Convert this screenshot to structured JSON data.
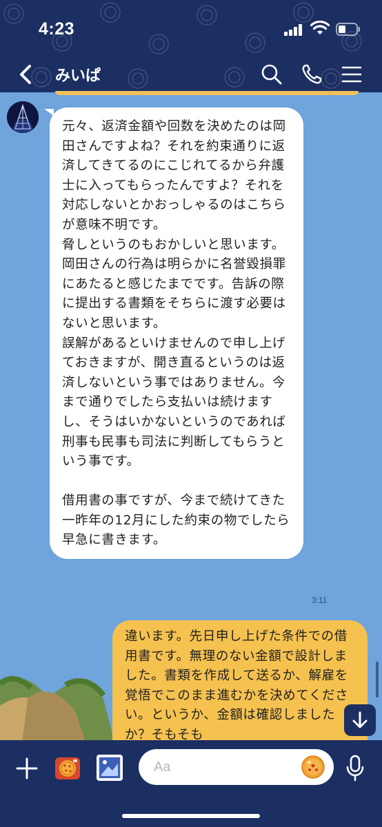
{
  "status_bar": {
    "time": "4:23"
  },
  "header": {
    "title": "みいぱ"
  },
  "messages": {
    "incoming_text": "元々、返済金額や回数を決めたのは岡田さんですよね？それを約束通りに返済してきてるのにこじれてるから弁護士に入ってもらったんですよ？それを対応しないとかおっしゃるのはこちらが意味不明です。\n脅しというのもおかしいと思います。岡田さんの行為は明らかに名誉毀損罪にあたると感じたまでです。告訴の際に提出する書類をそちらに渡す必要はないと思います。\n誤解があるといけませんので申し上げておきますが、開き直るというのは返済しないという事ではありません。今まで通りでしたら支払いは続けますし、そうはいかないというのであれば刑事も民事も司法に判断してもらうという事です。\n\n借用書の事ですが、今まで続けてきた一昨年の12月にした約束の物でしたら早急に書きます。",
    "incoming_time": "3:11",
    "outgoing_text": "違います。先日申し上げた条件での借用書です。無理のない金額で設計しました。書類を作成して送るか、解雇を覚悟でこのまま進むかを決めてください。というか、金額は確認しましたか？そもそも"
  },
  "input": {
    "placeholder": "Aa"
  },
  "icons": {
    "back": "chevron-left-icon",
    "search": "search-icon",
    "call": "phone-icon",
    "menu": "menu-icon",
    "add": "plus-icon",
    "camera": "camera-icon",
    "image": "image-icon",
    "emoji": "emoji-icon",
    "mic": "microphone-icon",
    "jump": "arrow-down-icon"
  },
  "colors": {
    "header_bg": "#1b2f63",
    "chat_bg": "#6fa4dc",
    "incoming_bubble": "#ffffff",
    "outgoing_bubble": "#f5c14f"
  }
}
